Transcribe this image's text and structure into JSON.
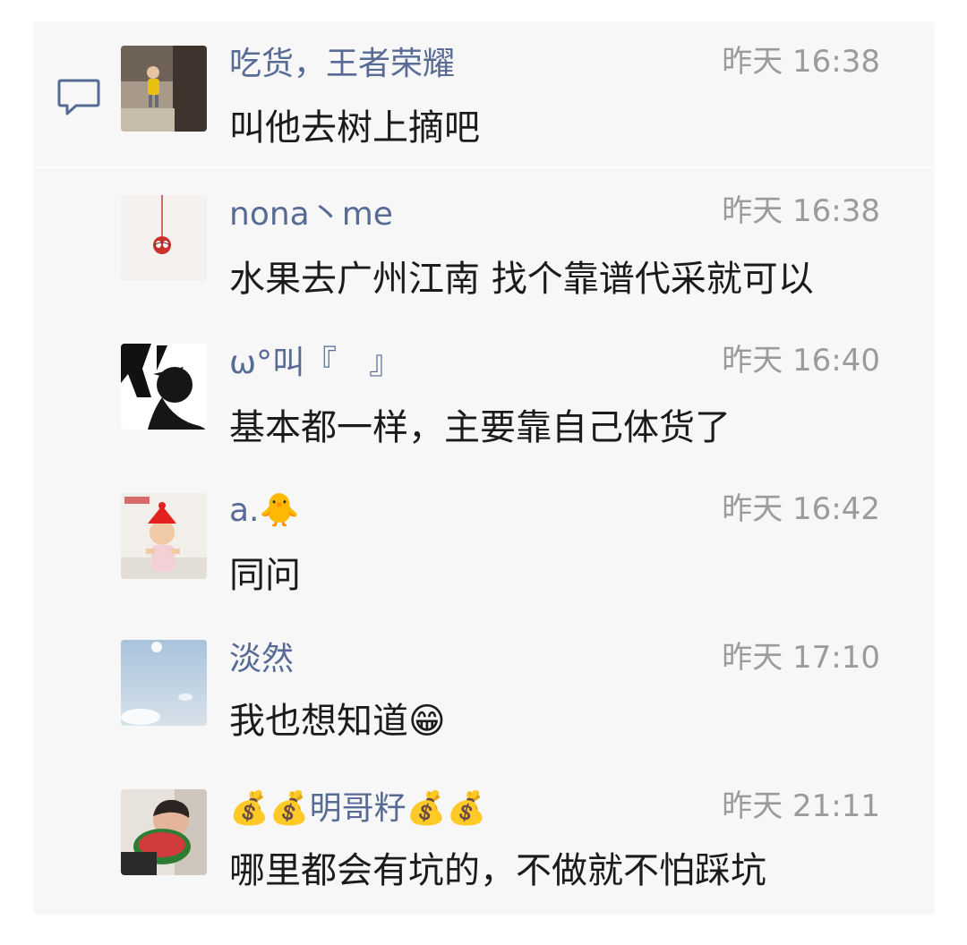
{
  "colors": {
    "name": "#576b95",
    "time": "#9b9b9b",
    "text": "#1b1b1b",
    "panel": "#f7f7f7"
  },
  "icons": {
    "comment": "comment-icon"
  },
  "comments": [
    {
      "name": "吃货，王者荣耀",
      "time": "昨天 16:38",
      "text": "叫他去树上摘吧",
      "avatar": "child-yellow-shirt-photo"
    },
    {
      "name": "nona丶me",
      "time": "昨天 16:38",
      "text": "水果去广州江南 找个靠谱代采就可以",
      "avatar": "spiderman-ornament-photo"
    },
    {
      "name": "ω°叫『　』",
      "time": "昨天 16:40",
      "text": "基本都一样，主要靠自己体货了",
      "avatar": "black-silhouette-drawing"
    },
    {
      "name": "a.🐥",
      "time": "昨天 16:42",
      "text": "同问",
      "avatar": "child-red-hat-photo"
    },
    {
      "name": "淡然",
      "time": "昨天 17:10",
      "text": "我也想知道😁",
      "avatar": "blue-sky-photo"
    },
    {
      "name": "💰💰明哥籽💰💰",
      "time": "昨天 21:11",
      "text": "哪里都会有坑的，不做就不怕踩坑",
      "avatar": "man-eating-watermelon-photo"
    }
  ]
}
